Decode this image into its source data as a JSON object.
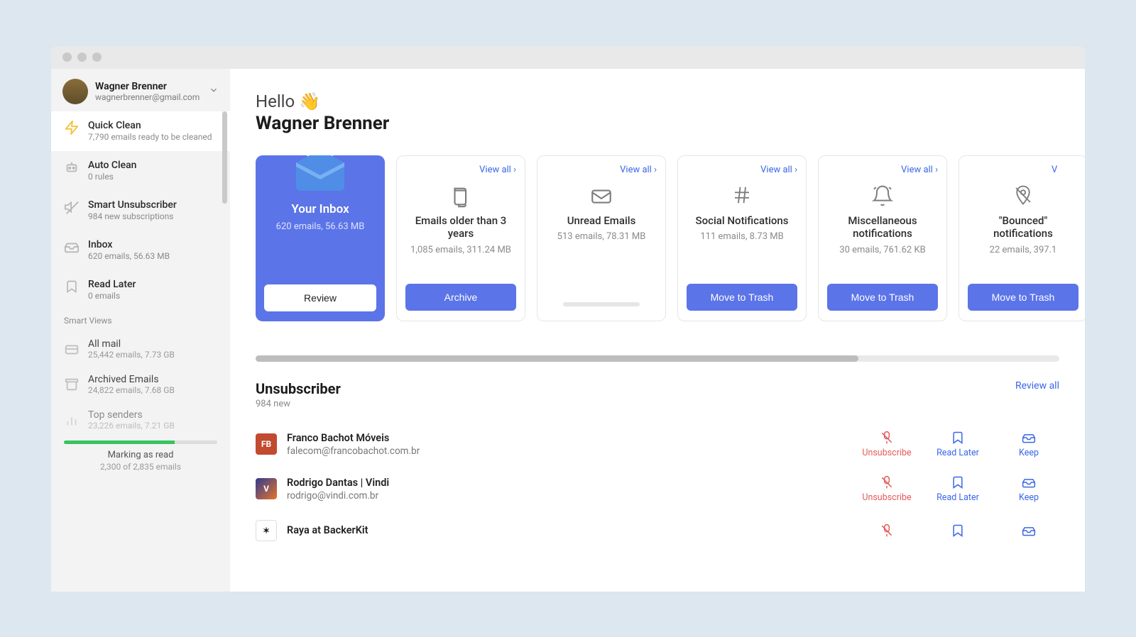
{
  "profile": {
    "name": "Wagner Brenner",
    "email": "wagnerbrenner@gmail.com"
  },
  "sidebar": {
    "quick_clean": {
      "title": "Quick Clean",
      "sub": "7,790 emails ready to be cleaned"
    },
    "auto_clean": {
      "title": "Auto Clean",
      "sub": "0 rules"
    },
    "smart_unsub": {
      "title": "Smart Unsubscriber",
      "sub": "984 new subscriptions"
    },
    "inbox": {
      "title": "Inbox",
      "sub": "620 emails, 56.63 MB"
    },
    "read_later": {
      "title": "Read Later",
      "sub": "0 emails"
    },
    "section_label": "Smart Views",
    "all_mail": {
      "title": "All mail",
      "sub": "25,442 emails, 7.73 GB"
    },
    "archived": {
      "title": "Archived Emails",
      "sub": "24,822 emails, 7.68 GB"
    },
    "top_senders": {
      "title": "Top senders",
      "sub": "23,226 emails, 7.21 GB"
    },
    "progress": {
      "label": "Marking as read",
      "detail": "2,300 of 2,835 emails",
      "pct": 72
    }
  },
  "greeting": {
    "hello": "Hello",
    "wave": "👋",
    "name": "Wagner Brenner"
  },
  "viewall_label": "View all",
  "cards": {
    "inbox": {
      "title": "Your Inbox",
      "sub": "620 emails, 56.63 MB",
      "btn": "Review"
    },
    "older": {
      "title": "Emails older than 3 years",
      "sub": "1,085 emails, 311.24 MB",
      "btn": "Archive"
    },
    "unread": {
      "title": "Unread Emails",
      "sub": "513 emails, 78.31 MB"
    },
    "social": {
      "title": "Social Notifications",
      "sub": "111 emails, 8.73 MB",
      "btn": "Move to Trash"
    },
    "misc": {
      "title": "Miscellaneous notifications",
      "sub": "30 emails, 761.62 KB",
      "btn": "Move to Trash"
    },
    "bounced": {
      "title": "\"Bounced\" notifications",
      "sub": "22 emails, 397.1",
      "btn": "Move to Trash"
    }
  },
  "unsub": {
    "title": "Unsubscriber",
    "sub": "984 new",
    "review_all": "Review all",
    "actions": {
      "unsubscribe": "Unsubscribe",
      "read_later": "Read Later",
      "keep": "Keep"
    },
    "rows": [
      {
        "name": "Franco Bachot Móveis",
        "email": "falecom@francobachot.com.br"
      },
      {
        "name": "Rodrigo Dantas | Vindi",
        "email": "rodrigo@vindi.com.br"
      },
      {
        "name": "Raya at BackerKit",
        "email": ""
      }
    ]
  }
}
